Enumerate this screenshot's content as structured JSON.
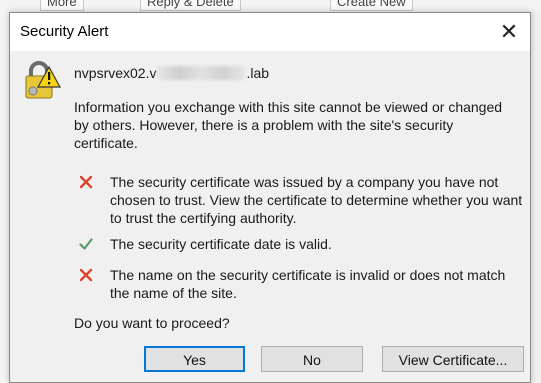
{
  "background": {
    "ribbon_items": [
      "More",
      "Reply & Delete",
      "Create New"
    ]
  },
  "dialog": {
    "title": "Security Alert",
    "close_glyph": "✕",
    "host_prefix": "nvpsrvex02.v",
    "host_suffix": ".lab",
    "info": "Information you exchange with this site cannot be viewed or changed by others. However, there is a problem with the site's security certificate.",
    "checks": [
      {
        "status": "fail",
        "icon": "red-x-icon",
        "text": "The security certificate was issued by a company you have not chosen to trust. View the certificate to determine whether you want to trust the certifying authority."
      },
      {
        "status": "pass",
        "icon": "green-check-icon",
        "text": "The security certificate date is valid."
      },
      {
        "status": "fail",
        "icon": "red-x-icon",
        "text": "The name on the security certificate is invalid or does not match the name of the site."
      }
    ],
    "prompt": "Do you want to proceed?",
    "buttons": {
      "yes": "Yes",
      "no": "No",
      "view_certificate": "View Certificate..."
    }
  },
  "colors": {
    "accent": "#0078d7",
    "fail": "#d9452b",
    "pass": "#5a9a6e",
    "warning_yellow": "#f5d312"
  }
}
